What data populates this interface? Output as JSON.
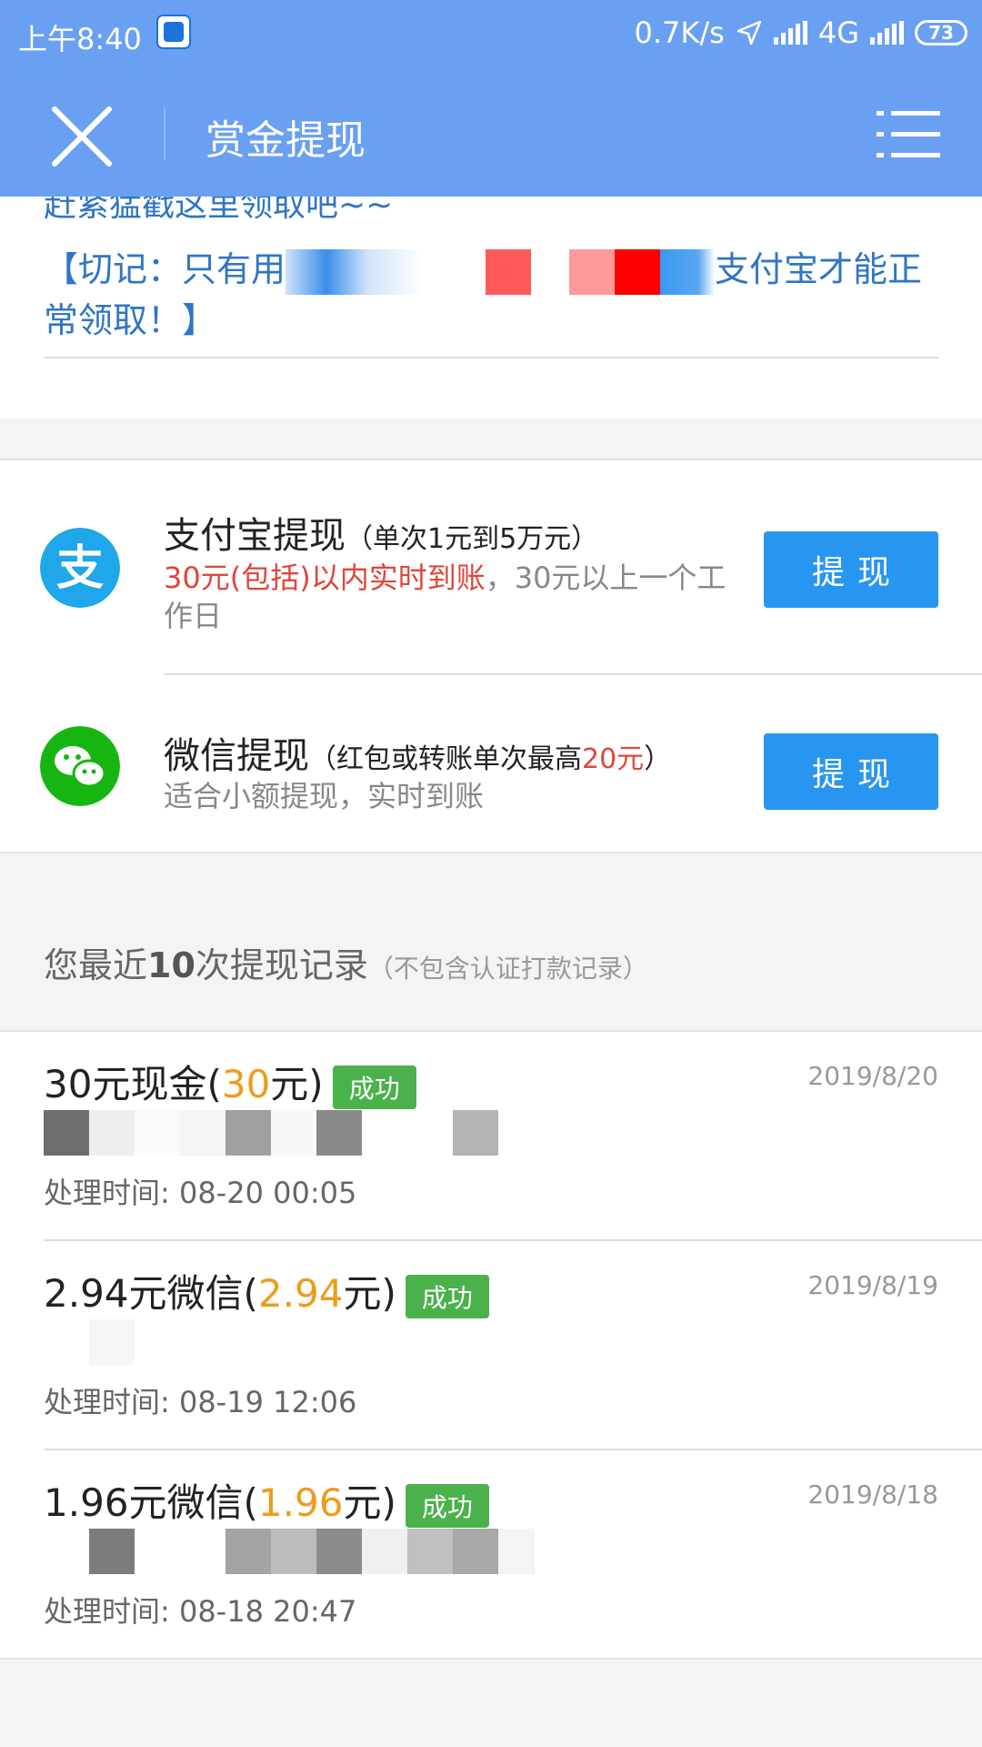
{
  "status_bar": {
    "time": "上午8:40",
    "net_speed": "0.7K/s",
    "network": "4G",
    "battery": "73"
  },
  "app_bar": {
    "title": "赏金提现",
    "close_icon": "close-icon",
    "menu_icon": "menu-list-icon"
  },
  "notice": {
    "line1": "赶紧猛戳这里领取吧~~",
    "line2_prefix": "【切记：只有用",
    "line2_suffix": "支付宝才能正常领取！】"
  },
  "methods": [
    {
      "icon": "alipay-icon",
      "title": "支付宝提现",
      "limit": "（单次1元到5万元）",
      "desc_red": "30元(包括)以内实时到账",
      "desc_rest": "，30元以上一个工作日",
      "button": "提现"
    },
    {
      "icon": "wechat-icon",
      "title": "微信提现",
      "limit_prefix": "（红包或转账单次最高",
      "limit_red": "20元",
      "limit_suffix": "）",
      "desc": "适合小额提现，实时到账",
      "button": "提现"
    }
  ],
  "records_header": {
    "prefix": "您最近",
    "count": "10",
    "suffix": "次提现记录",
    "note": "（不包含认证打款记录）"
  },
  "records": [
    {
      "label": "30元现金",
      "paren_open": "(",
      "value": "30",
      "paren_close": "元)",
      "status": "成功",
      "date": "2019/8/20",
      "processed": "处理时间: 08-20 00:05"
    },
    {
      "label": "2.94元微信",
      "paren_open": "(",
      "value": "2.94",
      "paren_close": "元)",
      "status": "成功",
      "date": "2019/8/19",
      "processed": "处理时间: 08-19 12:06"
    },
    {
      "label": "1.96元微信",
      "paren_open": "(",
      "value": "1.96",
      "paren_close": "元)",
      "status": "成功",
      "date": "2019/8/18",
      "processed": "处理时间: 08-18 20:47"
    }
  ],
  "colors": {
    "app_bar": "#6aa0f2",
    "button": "#2896f0",
    "success": "#4bb14b",
    "highlight_red": "#e0453a",
    "amount_orange": "#ee9b1c",
    "link_blue": "#2f76c4"
  }
}
